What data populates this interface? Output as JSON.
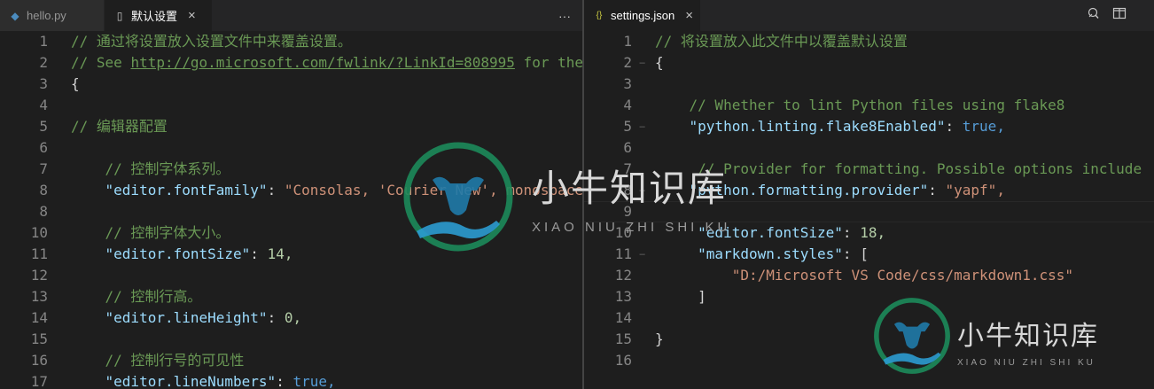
{
  "left_pane": {
    "tabs": [
      {
        "label": "hello.py",
        "icon": "python-file-icon",
        "active": false
      },
      {
        "label": "默认设置",
        "icon": "file-icon",
        "active": true,
        "close": "×"
      }
    ],
    "more_actions": "···",
    "lines": [
      {
        "n": "1",
        "c": "// 通过将设置放入设置文件中来覆盖设置。"
      },
      {
        "n": "2",
        "pre": "// See ",
        "link": "http://go.microsoft.com/fwlink/?LinkId=808995",
        "post": " for the"
      },
      {
        "n": "3",
        "c": "{"
      },
      {
        "n": "4"
      },
      {
        "n": "5",
        "c": "// 编辑器配置"
      },
      {
        "n": "6"
      },
      {
        "n": "7",
        "c": "    // 控制字体系列。"
      },
      {
        "n": "8",
        "k": "    \"editor.fontFamily\"",
        "v": "\"Consolas, 'Courier New', monospace\","
      },
      {
        "n": "8"
      },
      {
        "n": "10",
        "c": "    // 控制字体大小。"
      },
      {
        "n": "11",
        "k": "    \"editor.fontSize\"",
        "v": "14,"
      },
      {
        "n": "12"
      },
      {
        "n": "13",
        "c": "    // 控制行高。"
      },
      {
        "n": "14",
        "k": "    \"editor.lineHeight\"",
        "v": "0,"
      },
      {
        "n": "15"
      },
      {
        "n": "16",
        "c": "    // 控制行号的可见性"
      },
      {
        "n": "17",
        "k": "    \"editor.lineNumbers\"",
        "v": "true,"
      }
    ]
  },
  "right_pane": {
    "tabs": [
      {
        "label": "settings.json",
        "icon": "json-braces-icon",
        "active": true,
        "close": "×"
      }
    ],
    "lines": [
      {
        "n": "1",
        "c": "// 将设置放入此文件中以覆盖默认设置"
      },
      {
        "n": "2",
        "c": "{"
      },
      {
        "n": "3"
      },
      {
        "n": "4",
        "c": "    // Whether to lint Python files using flake8"
      },
      {
        "n": "5",
        "k": "    \"python.linting.flake8Enabled\"",
        "v": "true,"
      },
      {
        "n": "6"
      },
      {
        "n": "7",
        "c": "     // Provider for formatting. Possible options include"
      },
      {
        "n": "8",
        "k": "    \"python.formatting.provider\"",
        "v": "\"yapf\","
      },
      {
        "n": "9"
      },
      {
        "n": "10",
        "k": "     \"editor.fontSize\"",
        "v": "18,"
      },
      {
        "n": "11",
        "k": "     \"markdown.styles\"",
        "v": "["
      },
      {
        "n": "12",
        "c": "         \"D:/Microsoft VS Code/css/markdown1.css\""
      },
      {
        "n": "13",
        "c": "     ]"
      },
      {
        "n": "14"
      },
      {
        "n": "15",
        "c": "}"
      },
      {
        "n": "16"
      }
    ]
  },
  "watermark": {
    "name": "小牛知识库",
    "pinyin": "XIAO NIU ZHI SHI KU"
  },
  "colors": {
    "background": "#1e1e1e",
    "comment": "#6a9955",
    "key": "#9cdcfe",
    "string": "#ce9178",
    "number": "#b5cea8",
    "boolean": "#569cd6"
  }
}
